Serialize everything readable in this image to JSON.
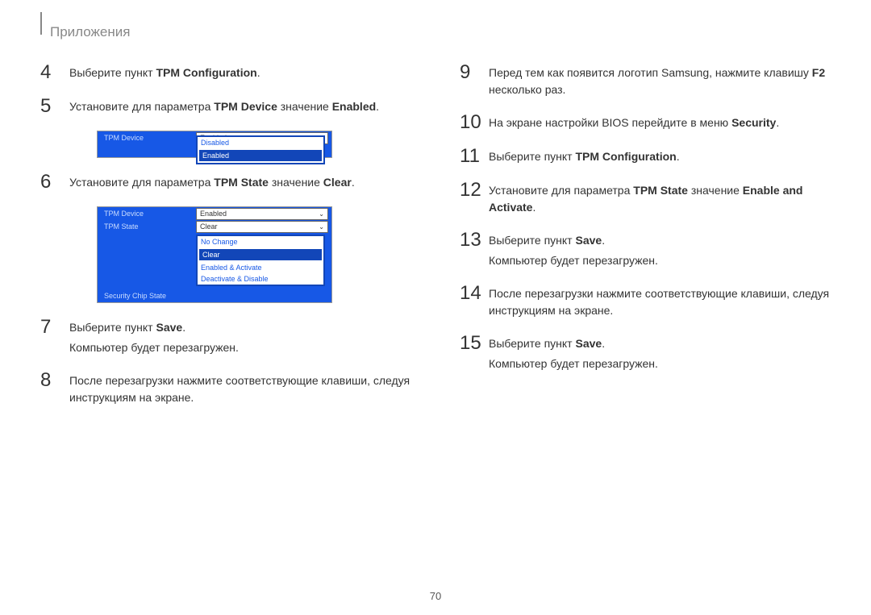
{
  "header": {
    "title": "Приложения"
  },
  "left": {
    "steps": [
      {
        "num": "4",
        "parts": [
          "Выберите пункт ",
          {
            "b": "TPM Configuration"
          },
          "."
        ]
      },
      {
        "num": "5",
        "parts": [
          "Установите для параметра ",
          {
            "b": "TPM Device"
          },
          " значение ",
          {
            "b": "Enabled"
          },
          "."
        ]
      },
      {
        "num": "6",
        "parts": [
          "Установите для параметра ",
          {
            "b": "TPM State"
          },
          " значение ",
          {
            "b": "Clear"
          },
          "."
        ]
      },
      {
        "num": "7",
        "parts": [
          "Выберите пункт ",
          {
            "b": "Save"
          },
          "."
        ],
        "extra": "Компьютер будет перезагружен."
      },
      {
        "num": "8",
        "parts": [
          "После перезагрузки нажмите соответствующие клавиши, следуя инструкциям на экране."
        ]
      }
    ]
  },
  "right": {
    "steps": [
      {
        "num": "9",
        "parts": [
          "Перед тем как появится логотип Samsung, нажмите клавишу ",
          {
            "b": "F2"
          },
          " несколько раз."
        ]
      },
      {
        "num": "10",
        "parts": [
          "На экране настройки BIOS перейдите в меню ",
          {
            "b": "Security"
          },
          "."
        ]
      },
      {
        "num": "11",
        "parts": [
          "Выберите пункт ",
          {
            "b": "TPM Configuration"
          },
          "."
        ]
      },
      {
        "num": "12",
        "parts": [
          "Установите для параметра ",
          {
            "b": "TPM State"
          },
          " значение ",
          {
            "b": "Enable and Activate"
          },
          "."
        ]
      },
      {
        "num": "13",
        "parts": [
          "Выберите пункт ",
          {
            "b": "Save"
          },
          "."
        ],
        "extra": "Компьютер будет перезагружен."
      },
      {
        "num": "14",
        "parts": [
          "После перезагрузки нажмите соответствующие клавиши, следуя инструкциям на экране."
        ]
      },
      {
        "num": "15",
        "parts": [
          "Выберите пункт ",
          {
            "b": "Save"
          },
          "."
        ],
        "extra": "Компьютер будет перезагружен."
      }
    ]
  },
  "bios1": {
    "label": "TPM Device",
    "value": "Enabled",
    "options": [
      "Disabled",
      "Enabled"
    ],
    "selected": "Enabled"
  },
  "bios2": {
    "rows": [
      {
        "label": "TPM Device",
        "value": "Enabled",
        "select": true
      },
      {
        "label": "TPM State",
        "value": "Clear",
        "select": true
      },
      {
        "label": "Security Chip State",
        "value": ""
      }
    ],
    "options": [
      "No Change",
      "Clear",
      "Enabled & Activate",
      "Deactivate & Disable"
    ],
    "selected": "Clear"
  },
  "pagenum": "70"
}
